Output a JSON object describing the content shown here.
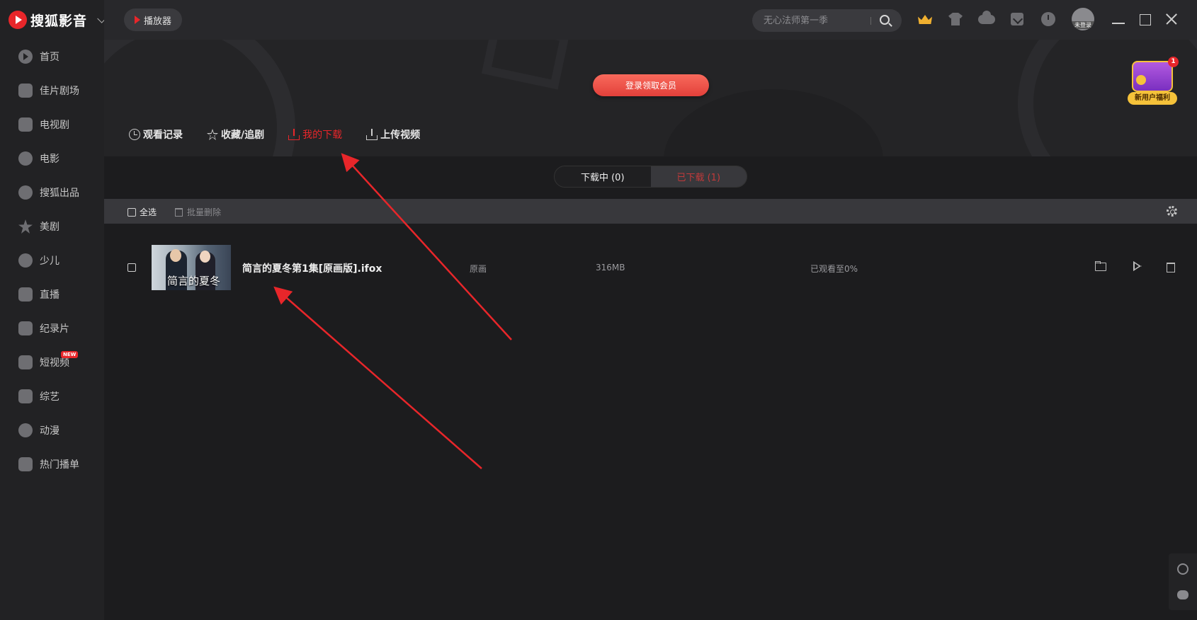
{
  "app": {
    "logo_text": "搜狐影音"
  },
  "topbar": {
    "player_label": "播放器",
    "search_placeholder": "无心法师第一季",
    "avatar_label": "未登录"
  },
  "sidebar": {
    "items": [
      {
        "label": "首页",
        "icon": "home-icon"
      },
      {
        "label": "佳片剧场",
        "icon": "theater-icon"
      },
      {
        "label": "电视剧",
        "icon": "tv-icon"
      },
      {
        "label": "电影",
        "icon": "film-reel-icon"
      },
      {
        "label": "搜狐出品",
        "icon": "sohu-original-icon"
      },
      {
        "label": "美剧",
        "icon": "star-icon"
      },
      {
        "label": "少儿",
        "icon": "kids-icon"
      },
      {
        "label": "直播",
        "icon": "live-camera-icon"
      },
      {
        "label": "纪录片",
        "icon": "documentary-icon"
      },
      {
        "label": "短视频",
        "icon": "short-video-icon",
        "badge": "NEW"
      },
      {
        "label": "综艺",
        "icon": "microphone-icon"
      },
      {
        "label": "动漫",
        "icon": "anime-icon"
      },
      {
        "label": "热门播单",
        "icon": "trophy-icon"
      }
    ]
  },
  "banner": {
    "login_label": "登录领取会员",
    "gift_label": "新用户福利",
    "gift_count": "1"
  },
  "tabs": [
    {
      "label": "观看记录",
      "icon": "clock-icon",
      "active": false
    },
    {
      "label": "收藏/追剧",
      "icon": "star-outline-icon",
      "active": false
    },
    {
      "label": "我的下载",
      "icon": "download-icon",
      "active": true
    },
    {
      "label": "上传视频",
      "icon": "upload-icon",
      "active": false
    }
  ],
  "segments": {
    "downloading": "下载中 (0)",
    "downloaded": "已下载 (1)"
  },
  "toolbar": {
    "select_all": "全选",
    "batch_delete": "批量删除"
  },
  "downloads": [
    {
      "title": "简言的夏冬第1集[原画版].ifox",
      "thumb_text": "简言的夏冬",
      "quality": "原画",
      "size": "316MB",
      "progress": "已观看至0%"
    }
  ],
  "colors": {
    "accent": "#e8262a",
    "background": "#1c1c1e",
    "sidebar": "#222224"
  }
}
